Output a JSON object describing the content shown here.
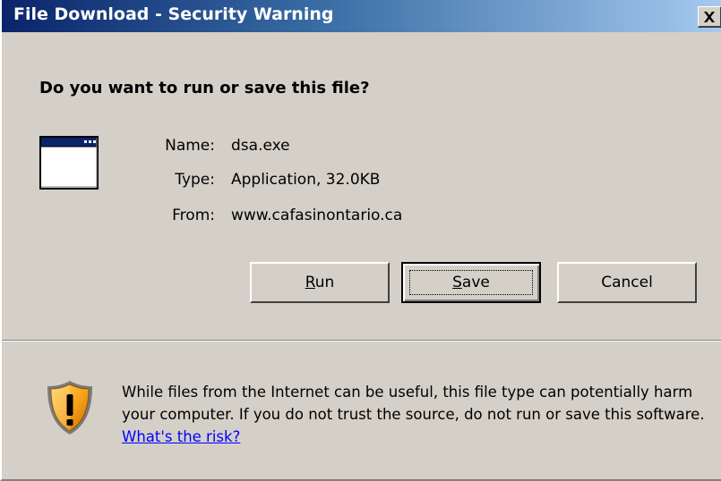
{
  "window": {
    "title": "File Download - Security Warning",
    "close_glyph": "✕"
  },
  "dialog": {
    "question": "Do you want to run or save this file?",
    "file_icon": "application-window-icon",
    "name_label": "Name:",
    "name_value": "dsa.exe",
    "type_label": "Type:",
    "type_value": "Application, 32.0KB",
    "from_label": "From:",
    "from_value": "www.cafasinontario.ca"
  },
  "buttons": {
    "run": {
      "label_mnemonic": "R",
      "label_rest": "un"
    },
    "save": {
      "label_mnemonic": "S",
      "label_rest": "ave",
      "is_default": true
    },
    "cancel": {
      "label": "Cancel"
    }
  },
  "warning": {
    "icon": "security-shield-icon",
    "text": "While files from the Internet can be useful, this file type can potentially harm your computer. If you do not trust the source, do not run or save this software.",
    "link_text": "What's the risk?"
  },
  "colors": {
    "titlebar_start": "#0a246a",
    "titlebar_end": "#a6caf0",
    "dialog_bg": "#d4d0c8",
    "link": "#0000ff",
    "shield_orange": "#f5a01a"
  }
}
